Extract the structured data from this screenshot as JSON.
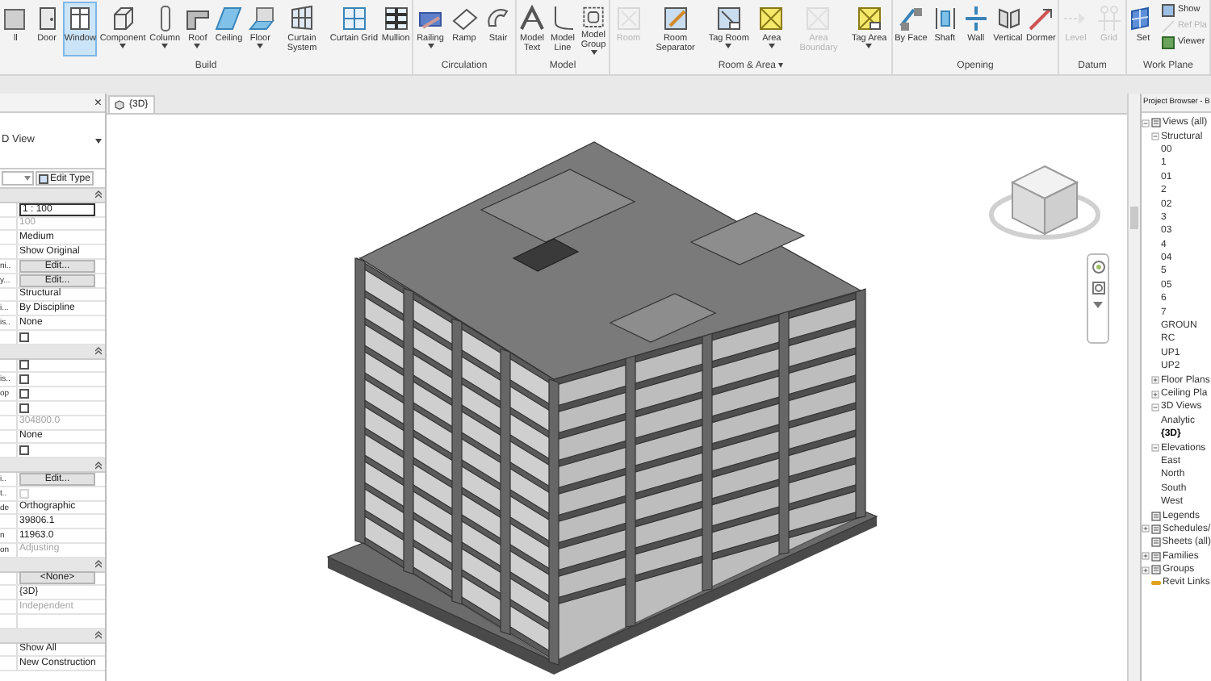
{
  "ribbon": {
    "groups": [
      {
        "label": "Build",
        "tools": [
          {
            "label": "ll",
            "selected": false,
            "disabled": false,
            "dropdown": false
          },
          {
            "label": "Door",
            "selected": false,
            "disabled": false,
            "dropdown": false
          },
          {
            "label": "Window",
            "selected": true,
            "disabled": false,
            "dropdown": false
          },
          {
            "label": "Component",
            "selected": false,
            "disabled": false,
            "dropdown": true
          },
          {
            "label": "Column",
            "selected": false,
            "disabled": false,
            "dropdown": true
          },
          {
            "label": "Roof",
            "selected": false,
            "disabled": false,
            "dropdown": true
          },
          {
            "label": "Ceiling",
            "selected": false,
            "disabled": false,
            "dropdown": false
          },
          {
            "label": "Floor",
            "selected": false,
            "disabled": false,
            "dropdown": true
          },
          {
            "label": "Curtain System",
            "selected": false,
            "disabled": false,
            "dropdown": false
          },
          {
            "label": "Curtain Grid",
            "selected": false,
            "disabled": false,
            "dropdown": false
          },
          {
            "label": "Mullion",
            "selected": false,
            "disabled": false,
            "dropdown": false
          }
        ]
      },
      {
        "label": "Circulation",
        "tools": [
          {
            "label": "Railing",
            "selected": false,
            "disabled": false,
            "dropdown": true
          },
          {
            "label": "Ramp",
            "selected": false,
            "disabled": false,
            "dropdown": false
          },
          {
            "label": "Stair",
            "selected": false,
            "disabled": false,
            "dropdown": false
          }
        ]
      },
      {
        "label": "Model",
        "tools": [
          {
            "label": "Model Text",
            "selected": false,
            "disabled": false,
            "dropdown": false
          },
          {
            "label": "Model Line",
            "selected": false,
            "disabled": false,
            "dropdown": false
          },
          {
            "label": "Model Group",
            "selected": false,
            "disabled": false,
            "dropdown": true
          }
        ]
      },
      {
        "label": "Room & Area ▾",
        "tools": [
          {
            "label": "Room",
            "selected": false,
            "disabled": true,
            "dropdown": false
          },
          {
            "label": "Room Separator",
            "selected": false,
            "disabled": false,
            "dropdown": false
          },
          {
            "label": "Tag Room",
            "selected": false,
            "disabled": false,
            "dropdown": true
          },
          {
            "label": "Area",
            "selected": false,
            "disabled": false,
            "dropdown": true
          },
          {
            "label": "Area Boundary",
            "selected": false,
            "disabled": true,
            "dropdown": false
          },
          {
            "label": "Tag Area",
            "selected": false,
            "disabled": false,
            "dropdown": true
          }
        ]
      },
      {
        "label": "Opening",
        "tools": [
          {
            "label": "By Face",
            "selected": false,
            "disabled": false,
            "dropdown": false
          },
          {
            "label": "Shaft",
            "selected": false,
            "disabled": false,
            "dropdown": false
          },
          {
            "label": "Wall",
            "selected": false,
            "disabled": false,
            "dropdown": false
          },
          {
            "label": "Vertical",
            "selected": false,
            "disabled": false,
            "dropdown": false
          },
          {
            "label": "Dormer",
            "selected": false,
            "disabled": false,
            "dropdown": false
          }
        ]
      },
      {
        "label": "Datum",
        "tools": [
          {
            "label": "Level",
            "selected": false,
            "disabled": true,
            "dropdown": false
          },
          {
            "label": "Grid",
            "selected": false,
            "disabled": true,
            "dropdown": false
          }
        ]
      },
      {
        "label": "Work Plane",
        "tools": [
          {
            "label": "Set",
            "selected": false,
            "disabled": false,
            "dropdown": false
          },
          {
            "label": "Show",
            "selected": false,
            "disabled": false,
            "dropdown": false
          },
          {
            "label": "Ref Pla",
            "selected": false,
            "disabled": true,
            "dropdown": false
          },
          {
            "label": "Viewer",
            "selected": false,
            "disabled": false,
            "dropdown": false
          }
        ]
      }
    ]
  },
  "properties": {
    "close": "×",
    "type_name": "D View",
    "edit_type": "Edit Type",
    "rows": [
      {
        "kind": "section"
      },
      {
        "kind": "field",
        "value": "1 : 100"
      },
      {
        "kind": "muted",
        "value": "100"
      },
      {
        "kind": "text",
        "value": "Medium"
      },
      {
        "kind": "text",
        "value": "Show Original"
      },
      {
        "kind": "button",
        "label": "ni..",
        "value": "Edit..."
      },
      {
        "kind": "button",
        "label": "y...",
        "value": "Edit..."
      },
      {
        "kind": "text",
        "value": "Structural"
      },
      {
        "kind": "text",
        "label": "i...",
        "value": "By Discipline"
      },
      {
        "kind": "text",
        "label": "is..",
        "value": "None"
      },
      {
        "kind": "checkbox",
        "checked": false,
        "disabled": false
      },
      {
        "kind": "section"
      },
      {
        "kind": "checkbox",
        "checked": false,
        "disabled": false
      },
      {
        "kind": "checkbox",
        "label": "is..",
        "checked": false,
        "disabled": false
      },
      {
        "kind": "checkbox",
        "label": "op",
        "checked": false,
        "disabled": false
      },
      {
        "kind": "checkbox",
        "checked": false,
        "disabled": false
      },
      {
        "kind": "muted",
        "value": "304800.0"
      },
      {
        "kind": "text",
        "value": "None"
      },
      {
        "kind": "checkbox",
        "checked": false,
        "disabled": false
      },
      {
        "kind": "section"
      },
      {
        "kind": "button",
        "label": "i..",
        "value": "Edit..."
      },
      {
        "kind": "checkbox",
        "label": "t..",
        "checked": false,
        "disabled": true
      },
      {
        "kind": "text",
        "label": "de",
        "value": "Orthographic"
      },
      {
        "kind": "text",
        "value": "39806.1"
      },
      {
        "kind": "text",
        "label": "n",
        "value": "11963.0"
      },
      {
        "kind": "muted",
        "label": "on",
        "value": "Adjusting"
      },
      {
        "kind": "section"
      },
      {
        "kind": "button",
        "value": "<None>"
      },
      {
        "kind": "text",
        "value": "{3D}"
      },
      {
        "kind": "muted",
        "value": "Independent"
      },
      {
        "kind": "blank"
      },
      {
        "kind": "section"
      },
      {
        "kind": "text",
        "value": "Show All"
      },
      {
        "kind": "text",
        "value": "New Construction"
      }
    ]
  },
  "view_tab": {
    "title": "{3D}"
  },
  "project_browser": {
    "title": "Project Browser - B",
    "tree": [
      {
        "label": "Views (all)",
        "expanded": true,
        "selected": false,
        "children": [
          {
            "label": "Structural",
            "expanded": true,
            "selected": false,
            "children": [
              {
                "label": "00",
                "selected": false
              },
              {
                "label": "1",
                "selected": false
              },
              {
                "label": "01",
                "selected": false
              },
              {
                "label": "2",
                "selected": false
              },
              {
                "label": "02",
                "selected": false
              },
              {
                "label": "3",
                "selected": false
              },
              {
                "label": "03",
                "selected": false
              },
              {
                "label": "4",
                "selected": false
              },
              {
                "label": "04",
                "selected": false
              },
              {
                "label": "5",
                "selected": false
              },
              {
                "label": "05",
                "selected": false
              },
              {
                "label": "6",
                "selected": false
              },
              {
                "label": "7",
                "selected": false
              },
              {
                "label": "GROUN",
                "selected": false
              },
              {
                "label": "RC",
                "selected": false
              },
              {
                "label": "UP1",
                "selected": false
              },
              {
                "label": "UP2",
                "selected": false
              }
            ]
          },
          {
            "label": "Floor Plans",
            "expanded": false,
            "selected": false
          },
          {
            "label": "Ceiling Pla",
            "expanded": false,
            "selected": false
          },
          {
            "label": "3D Views",
            "expanded": true,
            "selected": false,
            "children": [
              {
                "label": "Analytic",
                "selected": false
              },
              {
                "label": "{3D}",
                "selected": true
              }
            ]
          },
          {
            "label": "Elevations",
            "expanded": true,
            "selected": false,
            "children": [
              {
                "label": "East",
                "selected": false
              },
              {
                "label": "North",
                "selected": false
              },
              {
                "label": "South",
                "selected": false
              },
              {
                "label": "West",
                "selected": false
              }
            ]
          }
        ]
      },
      {
        "label": "Legends",
        "selected": false
      },
      {
        "label": "Schedules/",
        "expanded": false,
        "selected": false
      },
      {
        "label": "Sheets (all)",
        "selected": false
      },
      {
        "label": "Families",
        "expanded": false,
        "selected": false
      },
      {
        "label": "Groups",
        "expanded": false,
        "selected": false
      },
      {
        "label": "Revit Links",
        "selected": false
      }
    ]
  }
}
